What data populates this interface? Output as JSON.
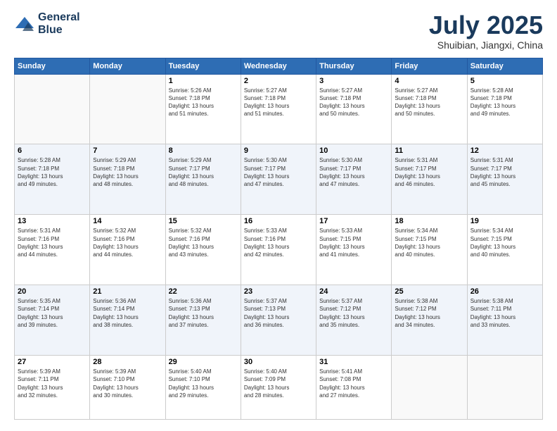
{
  "header": {
    "logo_line1": "General",
    "logo_line2": "Blue",
    "month": "July 2025",
    "location": "Shuibian, Jiangxi, China"
  },
  "days_of_week": [
    "Sunday",
    "Monday",
    "Tuesday",
    "Wednesday",
    "Thursday",
    "Friday",
    "Saturday"
  ],
  "weeks": [
    [
      {
        "day": "",
        "info": ""
      },
      {
        "day": "",
        "info": ""
      },
      {
        "day": "1",
        "info": "Sunrise: 5:26 AM\nSunset: 7:18 PM\nDaylight: 13 hours\nand 51 minutes."
      },
      {
        "day": "2",
        "info": "Sunrise: 5:27 AM\nSunset: 7:18 PM\nDaylight: 13 hours\nand 51 minutes."
      },
      {
        "day": "3",
        "info": "Sunrise: 5:27 AM\nSunset: 7:18 PM\nDaylight: 13 hours\nand 50 minutes."
      },
      {
        "day": "4",
        "info": "Sunrise: 5:27 AM\nSunset: 7:18 PM\nDaylight: 13 hours\nand 50 minutes."
      },
      {
        "day": "5",
        "info": "Sunrise: 5:28 AM\nSunset: 7:18 PM\nDaylight: 13 hours\nand 49 minutes."
      }
    ],
    [
      {
        "day": "6",
        "info": "Sunrise: 5:28 AM\nSunset: 7:18 PM\nDaylight: 13 hours\nand 49 minutes."
      },
      {
        "day": "7",
        "info": "Sunrise: 5:29 AM\nSunset: 7:18 PM\nDaylight: 13 hours\nand 48 minutes."
      },
      {
        "day": "8",
        "info": "Sunrise: 5:29 AM\nSunset: 7:17 PM\nDaylight: 13 hours\nand 48 minutes."
      },
      {
        "day": "9",
        "info": "Sunrise: 5:30 AM\nSunset: 7:17 PM\nDaylight: 13 hours\nand 47 minutes."
      },
      {
        "day": "10",
        "info": "Sunrise: 5:30 AM\nSunset: 7:17 PM\nDaylight: 13 hours\nand 47 minutes."
      },
      {
        "day": "11",
        "info": "Sunrise: 5:31 AM\nSunset: 7:17 PM\nDaylight: 13 hours\nand 46 minutes."
      },
      {
        "day": "12",
        "info": "Sunrise: 5:31 AM\nSunset: 7:17 PM\nDaylight: 13 hours\nand 45 minutes."
      }
    ],
    [
      {
        "day": "13",
        "info": "Sunrise: 5:31 AM\nSunset: 7:16 PM\nDaylight: 13 hours\nand 44 minutes."
      },
      {
        "day": "14",
        "info": "Sunrise: 5:32 AM\nSunset: 7:16 PM\nDaylight: 13 hours\nand 44 minutes."
      },
      {
        "day": "15",
        "info": "Sunrise: 5:32 AM\nSunset: 7:16 PM\nDaylight: 13 hours\nand 43 minutes."
      },
      {
        "day": "16",
        "info": "Sunrise: 5:33 AM\nSunset: 7:16 PM\nDaylight: 13 hours\nand 42 minutes."
      },
      {
        "day": "17",
        "info": "Sunrise: 5:33 AM\nSunset: 7:15 PM\nDaylight: 13 hours\nand 41 minutes."
      },
      {
        "day": "18",
        "info": "Sunrise: 5:34 AM\nSunset: 7:15 PM\nDaylight: 13 hours\nand 40 minutes."
      },
      {
        "day": "19",
        "info": "Sunrise: 5:34 AM\nSunset: 7:15 PM\nDaylight: 13 hours\nand 40 minutes."
      }
    ],
    [
      {
        "day": "20",
        "info": "Sunrise: 5:35 AM\nSunset: 7:14 PM\nDaylight: 13 hours\nand 39 minutes."
      },
      {
        "day": "21",
        "info": "Sunrise: 5:36 AM\nSunset: 7:14 PM\nDaylight: 13 hours\nand 38 minutes."
      },
      {
        "day": "22",
        "info": "Sunrise: 5:36 AM\nSunset: 7:13 PM\nDaylight: 13 hours\nand 37 minutes."
      },
      {
        "day": "23",
        "info": "Sunrise: 5:37 AM\nSunset: 7:13 PM\nDaylight: 13 hours\nand 36 minutes."
      },
      {
        "day": "24",
        "info": "Sunrise: 5:37 AM\nSunset: 7:12 PM\nDaylight: 13 hours\nand 35 minutes."
      },
      {
        "day": "25",
        "info": "Sunrise: 5:38 AM\nSunset: 7:12 PM\nDaylight: 13 hours\nand 34 minutes."
      },
      {
        "day": "26",
        "info": "Sunrise: 5:38 AM\nSunset: 7:11 PM\nDaylight: 13 hours\nand 33 minutes."
      }
    ],
    [
      {
        "day": "27",
        "info": "Sunrise: 5:39 AM\nSunset: 7:11 PM\nDaylight: 13 hours\nand 32 minutes."
      },
      {
        "day": "28",
        "info": "Sunrise: 5:39 AM\nSunset: 7:10 PM\nDaylight: 13 hours\nand 30 minutes."
      },
      {
        "day": "29",
        "info": "Sunrise: 5:40 AM\nSunset: 7:10 PM\nDaylight: 13 hours\nand 29 minutes."
      },
      {
        "day": "30",
        "info": "Sunrise: 5:40 AM\nSunset: 7:09 PM\nDaylight: 13 hours\nand 28 minutes."
      },
      {
        "day": "31",
        "info": "Sunrise: 5:41 AM\nSunset: 7:08 PM\nDaylight: 13 hours\nand 27 minutes."
      },
      {
        "day": "",
        "info": ""
      },
      {
        "day": "",
        "info": ""
      }
    ]
  ]
}
